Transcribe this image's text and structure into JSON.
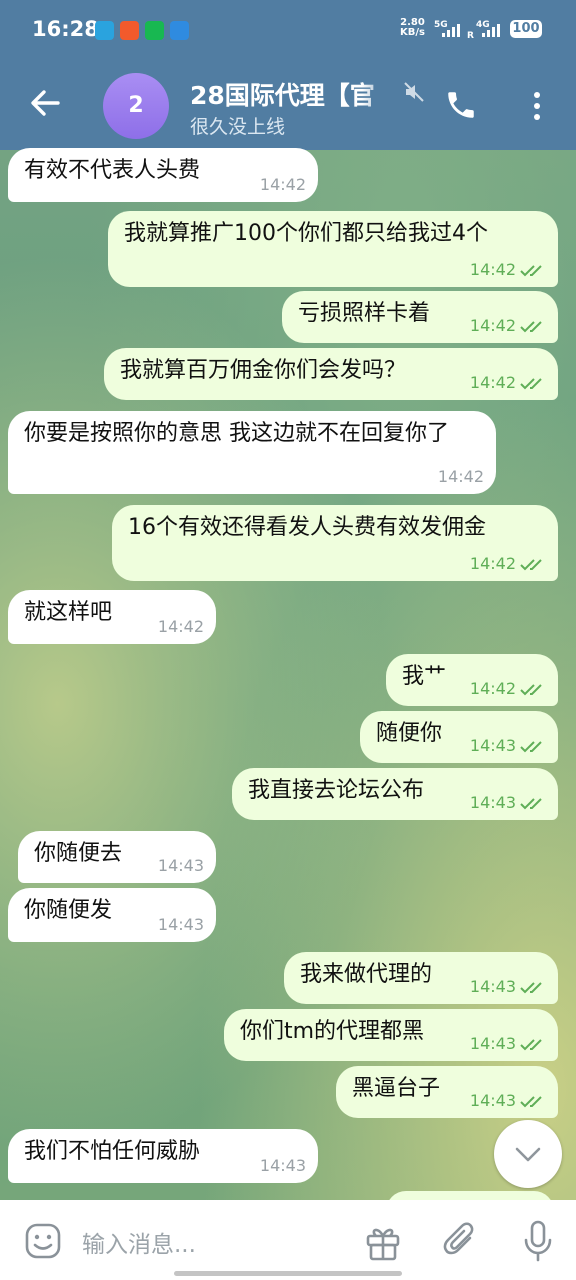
{
  "status_bar": {
    "time": "16:28",
    "speed_value": "2.80",
    "speed_unit": "KB/s",
    "sim1": "5G",
    "sim2": "4G",
    "sim2_sub": "R",
    "battery": "100",
    "app_icons": [
      "telegram-icon",
      "weibo-icon",
      "wechat-icon",
      "app-warning-icon"
    ]
  },
  "header": {
    "avatar_text": "2",
    "title": "28国际代理【官",
    "subtitle": "很久没上线",
    "icons": [
      "back-arrow-icon",
      "muted-icon",
      "phone-icon",
      "more-vertical-icon"
    ]
  },
  "messages": [
    {
      "dir": "in",
      "text": "有效不代表人头费",
      "time": "14:42"
    },
    {
      "dir": "out",
      "text": "我就算推广100个你们都只给我过4个",
      "time": "14:42"
    },
    {
      "dir": "out",
      "text": "亏损照样卡着",
      "time": "14:42"
    },
    {
      "dir": "out",
      "text": "我就算百万佣金你们会发吗？",
      "time": "14:42"
    },
    {
      "dir": "in",
      "text": "你要是按照你的意思 我这边就不在回复你了",
      "time": "14:42"
    },
    {
      "dir": "out",
      "text": "16个有效还得看发人头费有效发佣金",
      "time": "14:42"
    },
    {
      "dir": "in",
      "text": "就这样吧",
      "time": "14:42"
    },
    {
      "dir": "out",
      "text": "我艹",
      "time": "14:42"
    },
    {
      "dir": "out",
      "text": "随便你",
      "time": "14:43"
    },
    {
      "dir": "out",
      "text": "我直接去论坛公布",
      "time": "14:43"
    },
    {
      "dir": "in",
      "text": "你随便去",
      "time": "14:43"
    },
    {
      "dir": "in",
      "text": "你随便发",
      "time": "14:43"
    },
    {
      "dir": "out",
      "text": "我来做代理的",
      "time": "14:43"
    },
    {
      "dir": "out",
      "text": "你们tm的代理都黑",
      "time": "14:43"
    },
    {
      "dir": "out",
      "text": "黑逼台子",
      "time": "14:43"
    },
    {
      "dir": "in",
      "text": "我们不怕任何威胁",
      "time": "14:43"
    }
  ],
  "composer": {
    "placeholder": "输入消息...",
    "icons": [
      "emoji-icon",
      "gift-icon",
      "attach-icon",
      "mic-icon"
    ]
  },
  "colors": {
    "header_bg": "#517da2",
    "outgoing_bubble": "#effedd",
    "incoming_bubble": "#ffffff",
    "read_check": "#5fae57"
  }
}
